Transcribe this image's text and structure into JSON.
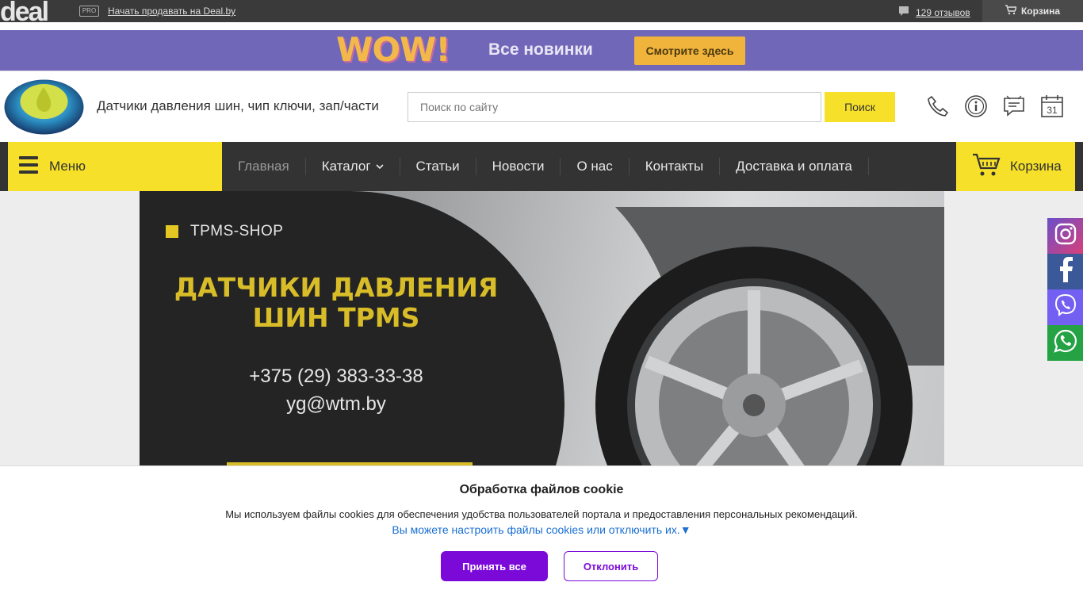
{
  "topbar": {
    "logo_text": "deal",
    "pro_badge": "PRO",
    "sell_link": "Начать продавать на Deal.by",
    "reviews_link": "129 отзывов",
    "cart_label": "Корзина"
  },
  "promo": {
    "wow_text": "WOW!",
    "text": "Все новинки",
    "button": "Смотрите здесь"
  },
  "header": {
    "site_title": "Датчики давления шин, чип ключи, зап/части",
    "search_placeholder": "Поиск по сайту",
    "search_button": "Поиск",
    "calendar_day": "31"
  },
  "nav": {
    "menu_label": "Меню",
    "items": [
      {
        "label": "Главная"
      },
      {
        "label": "Каталог"
      },
      {
        "label": "Статьи"
      },
      {
        "label": "Новости"
      },
      {
        "label": "О нас"
      },
      {
        "label": "Контакты"
      },
      {
        "label": "Доставка и оплата"
      }
    ],
    "cart_label": "Корзина"
  },
  "banner": {
    "shop_name": "TPMS-SHOP",
    "title": "ДАТЧИКИ ДАВЛЕНИЯ ШИН TPMS",
    "phone": "+375 (29) 383-33-38",
    "email": "yg@wtm.by"
  },
  "social": [
    "instagram-icon",
    "facebook-icon",
    "viber-icon",
    "whatsapp-icon"
  ],
  "colors": {
    "accent_yellow": "#f6e02a",
    "promo_purple": "#7167b8",
    "cookie_purple": "#7b0ad8",
    "link_blue": "#1a6fd1"
  },
  "cookie": {
    "title": "Обработка файлов cookie",
    "text": "Мы используем файлы cookies для обеспечения удобства пользователей портала и предоставления персональных рекомендаций.",
    "settings_link": "Вы можете настроить файлы cookies или отключить их.▼",
    "accept": "Принять все",
    "decline": "Отклонить"
  }
}
